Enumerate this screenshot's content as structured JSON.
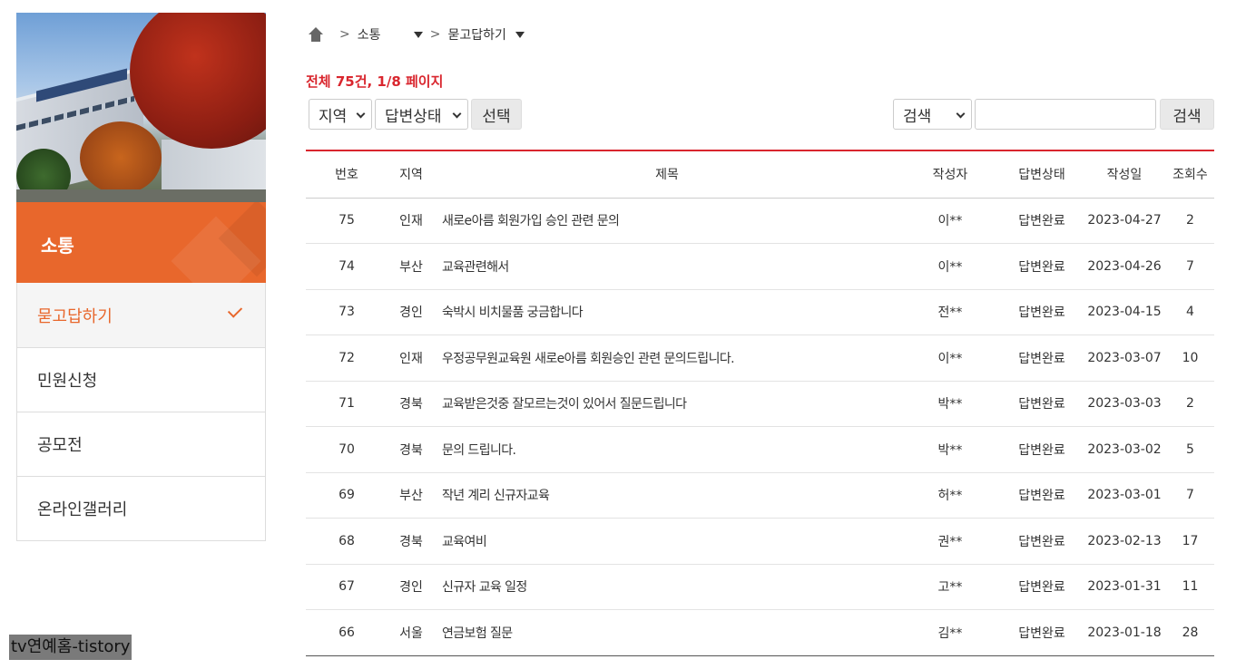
{
  "sidebar": {
    "title": "소통",
    "items": [
      {
        "label": "묻고답하기",
        "active": true
      },
      {
        "label": "민원신청",
        "active": false
      },
      {
        "label": "공모전",
        "active": false
      },
      {
        "label": "온라인갤러리",
        "active": false
      }
    ]
  },
  "breadcrumb": {
    "separator": ">",
    "level1": "소통",
    "level2": "묻고답하기"
  },
  "summary": {
    "count_text": "전체 75건, 1/8 페이지"
  },
  "filters": {
    "region_select": "지역",
    "status_select": "답변상태",
    "apply_button": "선택",
    "search_type_select": "검색",
    "search_value": "",
    "search_button": "검색"
  },
  "table": {
    "headers": [
      "번호",
      "지역",
      "제목",
      "작성자",
      "답변상태",
      "작성일",
      "조회수"
    ],
    "rows": [
      {
        "no": "75",
        "region": "인재",
        "subject": "새로e아름 회원가입 승인 관련 문의",
        "author": "이**",
        "status": "답변완료",
        "date": "2023-04-27",
        "views": "2"
      },
      {
        "no": "74",
        "region": "부산",
        "subject": "교육관련해서",
        "author": "이**",
        "status": "답변완료",
        "date": "2023-04-26",
        "views": "7"
      },
      {
        "no": "73",
        "region": "경인",
        "subject": "숙박시 비치물품 궁금합니다",
        "author": "전**",
        "status": "답변완료",
        "date": "2023-04-15",
        "views": "4"
      },
      {
        "no": "72",
        "region": "인재",
        "subject": "우정공무원교육원 새로e아름 회원승인 관련 문의드립니다.",
        "author": "이**",
        "status": "답변완료",
        "date": "2023-03-07",
        "views": "10"
      },
      {
        "no": "71",
        "region": "경북",
        "subject": "교육받은것중 잘모르는것이 있어서 질문드립니다",
        "author": "박**",
        "status": "답변완료",
        "date": "2023-03-03",
        "views": "2"
      },
      {
        "no": "70",
        "region": "경북",
        "subject": "문의 드립니다.",
        "author": "박**",
        "status": "답변완료",
        "date": "2023-03-02",
        "views": "5"
      },
      {
        "no": "69",
        "region": "부산",
        "subject": "작년 계리 신규자교육",
        "author": "허**",
        "status": "답변완료",
        "date": "2023-03-01",
        "views": "7"
      },
      {
        "no": "68",
        "region": "경북",
        "subject": "교육여비",
        "author": "권**",
        "status": "답변완료",
        "date": "2023-02-13",
        "views": "17"
      },
      {
        "no": "67",
        "region": "경인",
        "subject": "신규자 교육 일정",
        "author": "고**",
        "status": "답변완료",
        "date": "2023-01-31",
        "views": "11"
      },
      {
        "no": "66",
        "region": "서울",
        "subject": "연금보험 질문",
        "author": "김**",
        "status": "답변완료",
        "date": "2023-01-18",
        "views": "28"
      }
    ]
  },
  "watermark": "tv연예홈-tistory",
  "colors": {
    "accent": "#e8672c",
    "count_red": "#d9262e"
  }
}
